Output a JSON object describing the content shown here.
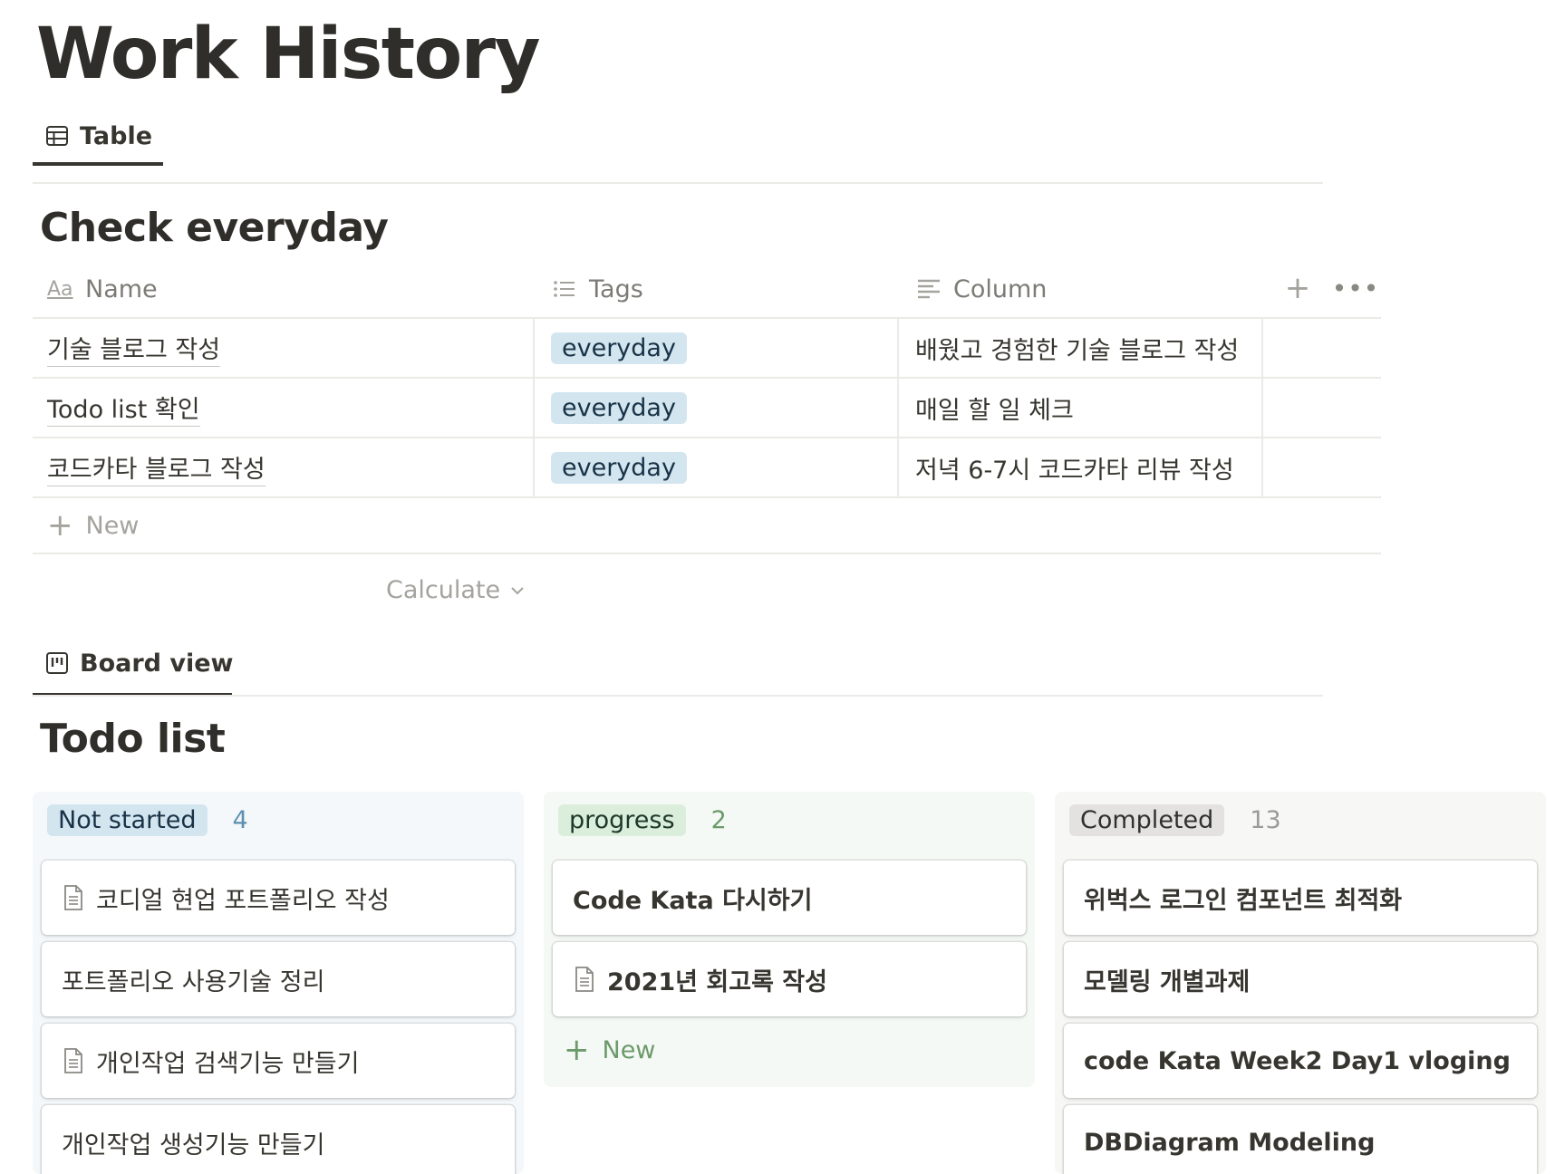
{
  "page": {
    "title": "Work History"
  },
  "table_view": {
    "tab_label": "Table",
    "title": "Check everyday",
    "columns": {
      "name": "Name",
      "tags": "Tags",
      "column": "Column"
    },
    "rows": [
      {
        "name": "기술 블로그 작성",
        "tag": "everyday",
        "column": "배웠고 경험한 기술 블로그 작성"
      },
      {
        "name": "Todo list 확인",
        "tag": "everyday",
        "column": "매일 할 일 체크"
      },
      {
        "name": "코드카타 블로그 작성",
        "tag": "everyday",
        "column": "저녁 6-7시 코드카타 리뷰 작성"
      }
    ],
    "new_label": "New",
    "calculate_label": "Calculate"
  },
  "board_view": {
    "tab_label": "Board view",
    "title": "Todo list",
    "groups": [
      {
        "label": "Not started",
        "count": "4",
        "cards": [
          {
            "title": "코디얼 현업 포트폴리오 작성",
            "icon": "document-icon"
          },
          {
            "title": "포트폴리오 사용기술 정리",
            "icon": ""
          },
          {
            "title": "개인작업 검색기능 만들기",
            "icon": "document-icon"
          },
          {
            "title": "개인작업 생성기능 만들기",
            "icon": ""
          }
        ]
      },
      {
        "label": "progress",
        "count": "2",
        "cards": [
          {
            "title": "Code Kata 다시하기",
            "icon": ""
          },
          {
            "title": "2021년 회고록 작성",
            "icon": "document-icon"
          }
        ],
        "new_label": "New"
      },
      {
        "label": "Completed",
        "count": "13",
        "cards": [
          {
            "title": "위벅스 로그인 컴포넌트 최적화",
            "icon": ""
          },
          {
            "title": "모델링 개별과제",
            "icon": ""
          },
          {
            "title": "code Kata Week2 Day1 vloging",
            "icon": ""
          },
          {
            "title": "DBDiagram Modeling",
            "icon": ""
          }
        ]
      }
    ]
  },
  "colors": {
    "text": "#37352f",
    "tag_blue_bg": "#d3e5ef",
    "not_started_bg": "#f4f8fb",
    "not_started_label_bg": "#d3e5ef",
    "not_started_count": "#5d8fb1",
    "progress_bg": "#f5f9f5",
    "progress_label_bg": "#dbeddb",
    "progress_count": "#6b9a6b",
    "completed_bg": "#f7f7f5",
    "completed_label_bg": "#e3e2e0",
    "completed_count": "#9b9a97"
  }
}
